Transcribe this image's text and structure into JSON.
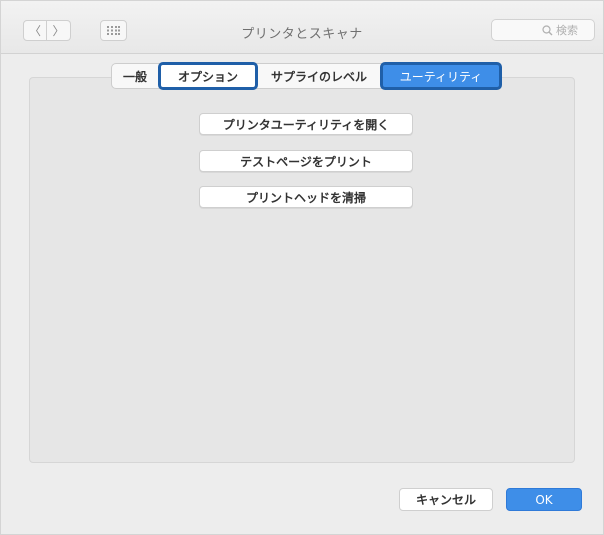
{
  "window": {
    "title": "プリンタとスキャナ"
  },
  "toolbar": {
    "back_icon": "chevron-left-icon",
    "forward_icon": "chevron-right-icon",
    "back_glyph": "〈",
    "forward_glyph": "〉",
    "grid_icon": "grid-icon",
    "search_placeholder": "検索"
  },
  "tabs": [
    {
      "label": "一般",
      "selected": false
    },
    {
      "label": "オプション",
      "selected": false
    },
    {
      "label": "サプライのレベル",
      "selected": false
    },
    {
      "label": "ユーティリティ",
      "selected": true
    }
  ],
  "actions": {
    "open_utility": "プリンタユーティリティを開く",
    "test_page": "テストページをプリント",
    "clean_head": "プリントヘッドを清掃"
  },
  "footer": {
    "cancel_label": "キャンセル",
    "ok_label": "OK"
  },
  "colors": {
    "accent": "#3e8ee8",
    "highlight_outline": "#1f5fa8"
  }
}
